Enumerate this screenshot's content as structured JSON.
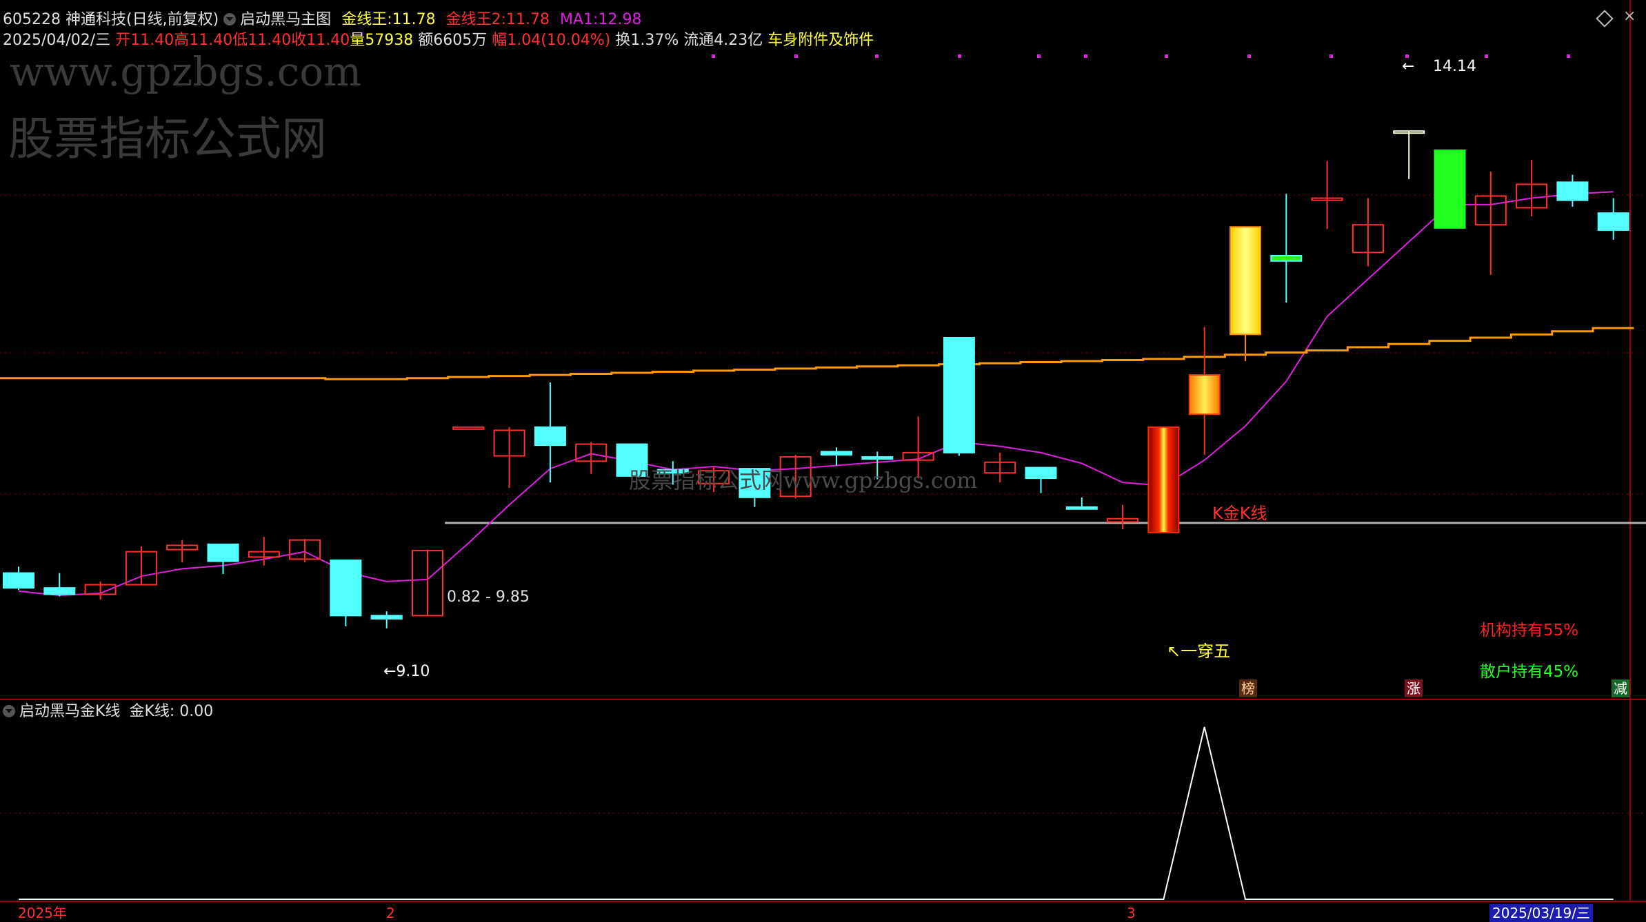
{
  "colors": {
    "up": "#ff3030",
    "down": "#54ffff",
    "ma1": "#e020e0",
    "gold_line": "#ff9900",
    "grid": "#8b0000",
    "support": "#b0b0b0",
    "label_yellow": "#ffff33",
    "label_red": "#ff2020",
    "label_green": "#20ff20"
  },
  "header": {
    "code": "605228",
    "name": "神通科技",
    "period": "(日线,前复权)",
    "indicator": "启动黑马主图",
    "jxw_label": "金线王:",
    "jxw_value": "11.78",
    "jxw2_label": "金线王2:",
    "jxw2_value": "11.78",
    "ma1_label": "MA1:",
    "ma1_value": "12.98",
    "line2": {
      "date": "2025/04/02/三",
      "open_label": "开",
      "open": "11.40",
      "high_label": "高",
      "high": "11.40",
      "low_label": "低",
      "low": "11.40",
      "close_label": "收",
      "close": "11.40",
      "vol_label": "量",
      "vol": "57938",
      "amt_label": "额",
      "amt": "6605万",
      "chg_label": "幅",
      "chg": "1.04(10.04%)",
      "turn_label": "换",
      "turn": "1.37%",
      "float_label": "流通",
      "float": "4.23亿",
      "sector": "车身附件及饰件"
    }
  },
  "watermarks": {
    "url": "www.gpzbgs.com",
    "site": "股票指标公式网",
    "center": "股票指标公式网www.gpzbgs.com"
  },
  "labels": {
    "high_price": "14.14",
    "low_price": "←9.10",
    "range": "0.82 - 9.85",
    "kline": "K金K线",
    "chuanwu": "↖一穿五",
    "inst": "机构持有55%",
    "retail": "散户持有45%",
    "tag_bang": "榜",
    "tag_zhang": "涨",
    "tag_jian": "减"
  },
  "sub": {
    "indicator": "启动黑马金K线",
    "value_label": "金K线:",
    "value": "0.00"
  },
  "axis": {
    "labels": [
      "2025年",
      "2",
      "3"
    ],
    "cursor_date": "2025/03/19/三"
  },
  "chart_data": [
    {
      "type": "candlestick",
      "ylim": [
        8.9,
        14.4
      ],
      "candles": [
        {
          "o": 9.99,
          "h": 10.05,
          "l": 9.83,
          "c": 9.85,
          "style": "down"
        },
        {
          "o": 9.85,
          "h": 9.99,
          "l": 9.77,
          "c": 9.79,
          "style": "down"
        },
        {
          "o": 9.79,
          "h": 9.91,
          "l": 9.74,
          "c": 9.88,
          "style": "up"
        },
        {
          "o": 9.88,
          "h": 10.24,
          "l": 9.88,
          "c": 10.19,
          "style": "up"
        },
        {
          "o": 10.21,
          "h": 10.3,
          "l": 10.09,
          "c": 10.25,
          "style": "up"
        },
        {
          "o": 10.26,
          "h": 10.26,
          "l": 9.98,
          "c": 10.1,
          "style": "down"
        },
        {
          "o": 10.14,
          "h": 10.33,
          "l": 10.06,
          "c": 10.19,
          "style": "up"
        },
        {
          "o": 10.12,
          "h": 10.31,
          "l": 10.09,
          "c": 10.3,
          "style": "up"
        },
        {
          "o": 10.11,
          "h": 10.11,
          "l": 9.49,
          "c": 9.59,
          "style": "down"
        },
        {
          "o": 9.59,
          "h": 9.63,
          "l": 9.47,
          "c": 9.56,
          "style": "down"
        },
        {
          "o": 9.59,
          "h": 10.21,
          "l": 9.59,
          "c": 10.2,
          "style": "up"
        },
        {
          "o": 11.36,
          "h": 11.36,
          "l": 11.36,
          "c": 11.36,
          "style": "up"
        },
        {
          "o": 11.09,
          "h": 11.36,
          "l": 10.79,
          "c": 11.33,
          "style": "up"
        },
        {
          "o": 11.36,
          "h": 11.78,
          "l": 10.84,
          "c": 11.19,
          "style": "down"
        },
        {
          "o": 11.04,
          "h": 11.22,
          "l": 10.92,
          "c": 11.2,
          "style": "up"
        },
        {
          "o": 11.2,
          "h": 11.2,
          "l": 10.87,
          "c": 10.9,
          "style": "down"
        },
        {
          "o": 10.96,
          "h": 11.04,
          "l": 10.82,
          "c": 10.93,
          "style": "down"
        },
        {
          "o": 10.83,
          "h": 10.99,
          "l": 10.75,
          "c": 10.95,
          "style": "up"
        },
        {
          "o": 10.97,
          "h": 10.97,
          "l": 10.61,
          "c": 10.7,
          "style": "down"
        },
        {
          "o": 10.71,
          "h": 11.1,
          "l": 10.69,
          "c": 11.08,
          "style": "up"
        },
        {
          "o": 11.13,
          "h": 11.17,
          "l": 11.0,
          "c": 11.1,
          "style": "down"
        },
        {
          "o": 11.08,
          "h": 11.13,
          "l": 10.87,
          "c": 11.07,
          "style": "down"
        },
        {
          "o": 11.05,
          "h": 11.46,
          "l": 10.88,
          "c": 11.12,
          "style": "up"
        },
        {
          "o": 12.2,
          "h": 12.2,
          "l": 11.09,
          "c": 11.12,
          "style": "down"
        },
        {
          "o": 10.93,
          "h": 11.12,
          "l": 10.84,
          "c": 11.03,
          "style": "up"
        },
        {
          "o": 10.88,
          "h": 10.98,
          "l": 10.74,
          "c": 10.98,
          "style": "down"
        },
        {
          "o": 10.6,
          "h": 10.7,
          "l": 10.6,
          "c": 10.61,
          "style": "down"
        },
        {
          "o": 10.5,
          "h": 10.63,
          "l": 10.4,
          "c": 10.47,
          "style": "up"
        },
        {
          "o": 10.37,
          "h": 11.36,
          "l": 10.37,
          "c": 11.36,
          "style": "gold_k"
        },
        {
          "o": 11.85,
          "h": 12.3,
          "l": 11.1,
          "c": 11.48,
          "style": "gold_k"
        },
        {
          "o": 12.23,
          "h": 12.23,
          "l": 11.98,
          "c": 13.24,
          "style": "yellow_k"
        },
        {
          "o": 12.97,
          "h": 13.55,
          "l": 12.53,
          "c": 12.92,
          "style": "up_green"
        },
        {
          "o": 13.49,
          "h": 13.86,
          "l": 13.22,
          "c": 13.51,
          "style": "up"
        },
        {
          "o": 13.0,
          "h": 13.51,
          "l": 12.87,
          "c": 13.26,
          "style": "up"
        },
        {
          "o": 14.14,
          "h": 14.14,
          "l": 13.69,
          "c": 14.14,
          "style": "up_pale"
        },
        {
          "o": 13.96,
          "h": 13.96,
          "l": 13.23,
          "c": 13.23,
          "style": "down_green"
        },
        {
          "o": 13.53,
          "h": 13.76,
          "l": 12.79,
          "c": 13.26,
          "style": "up"
        },
        {
          "o": 13.64,
          "h": 13.87,
          "l": 13.34,
          "c": 13.42,
          "style": "up"
        },
        {
          "o": 13.49,
          "h": 13.73,
          "l": 13.43,
          "c": 13.66,
          "style": "down"
        },
        {
          "o": 13.37,
          "h": 13.51,
          "l": 13.12,
          "c": 13.21,
          "style": "down"
        }
      ],
      "ma1": [
        9.82,
        9.78,
        9.8,
        9.96,
        10.03,
        10.06,
        10.12,
        10.19,
        10.0,
        9.91,
        9.93,
        10.27,
        10.63,
        10.97,
        11.11,
        11.04,
        10.96,
        10.99,
        10.95,
        10.97,
        11.0,
        11.03,
        11.06,
        11.22,
        11.18,
        11.12,
        11.02,
        10.84,
        10.81,
        11.05,
        11.37,
        11.79,
        12.4,
        12.75,
        13.1,
        13.45,
        13.45,
        13.51,
        13.55,
        13.57,
        13.6,
        13.35
      ],
      "gold_line": [
        11.82,
        11.82,
        11.82,
        11.82,
        11.82,
        11.82,
        11.82,
        11.82,
        11.81,
        11.81,
        11.82,
        11.83,
        11.84,
        11.85,
        11.86,
        11.87,
        11.88,
        11.89,
        11.9,
        11.91,
        11.92,
        11.93,
        11.94,
        11.95,
        11.96,
        11.97,
        11.98,
        11.99,
        12.0,
        12.02,
        12.04,
        12.06,
        12.08,
        12.11,
        12.14,
        12.17,
        12.2,
        12.23,
        12.26,
        12.29
      ],
      "support": 10.46
    },
    {
      "type": "line",
      "series": [
        {
          "values": [
            0,
            0,
            0,
            0,
            0,
            0,
            0,
            0,
            0,
            0,
            0,
            0,
            0,
            0,
            0,
            0,
            0,
            0,
            0,
            0,
            0,
            0,
            0,
            0,
            0,
            0,
            0,
            0,
            0,
            1,
            0,
            0,
            0,
            0,
            0,
            0,
            0,
            0,
            0,
            0
          ]
        }
      ],
      "ylim": [
        0,
        1
      ]
    }
  ]
}
